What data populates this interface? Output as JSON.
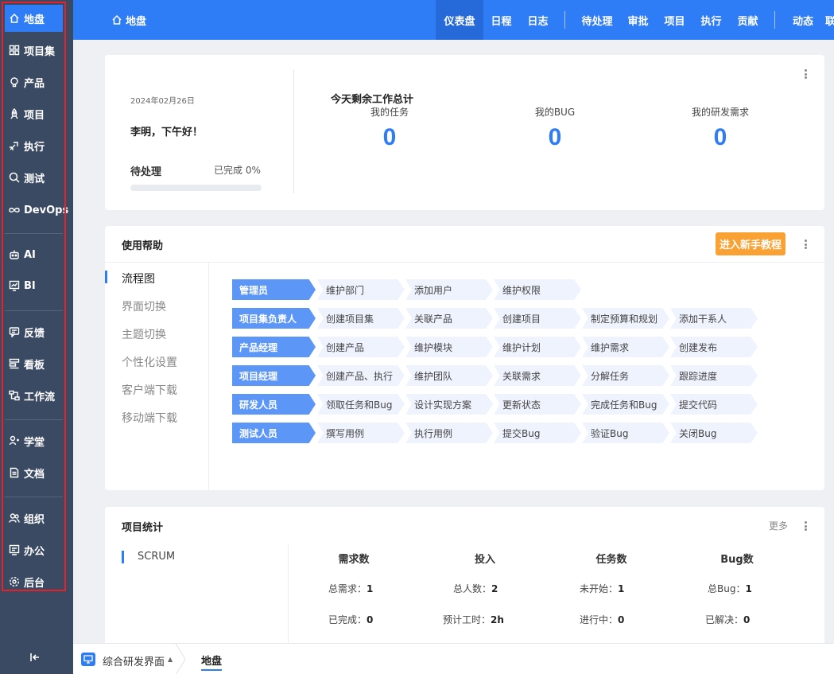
{
  "sidebar": {
    "items": [
      {
        "label": "地盘",
        "icon": "home-icon",
        "active": true
      },
      {
        "label": "项目集",
        "icon": "grid-icon"
      },
      {
        "label": "产品",
        "icon": "lightbulb-icon"
      },
      {
        "label": "项目",
        "icon": "rocket-icon"
      },
      {
        "label": "执行",
        "icon": "execute-icon"
      },
      {
        "label": "测试",
        "icon": "search-icon"
      },
      {
        "label": "DevOps",
        "icon": "infinity-icon"
      },
      {
        "label": "AI",
        "icon": "robot-icon"
      },
      {
        "label": "BI",
        "icon": "chart-icon"
      },
      {
        "label": "反馈",
        "icon": "feedback-icon"
      },
      {
        "label": "看板",
        "icon": "kanban-icon"
      },
      {
        "label": "工作流",
        "icon": "workflow-icon"
      },
      {
        "label": "学堂",
        "icon": "school-icon"
      },
      {
        "label": "文档",
        "icon": "document-icon"
      },
      {
        "label": "组织",
        "icon": "people-icon"
      },
      {
        "label": "办公",
        "icon": "office-icon"
      },
      {
        "label": "后台",
        "icon": "gear-icon"
      }
    ],
    "collapse_icon": "collapse-icon"
  },
  "topbar": {
    "title": "地盘",
    "tabs": [
      "仪表盘",
      "日程",
      "日志",
      "待处理",
      "审批",
      "项目",
      "执行",
      "贡献",
      "动态",
      "联"
    ],
    "active_tab": "仪表盘"
  },
  "summary": {
    "date": "2024年02月26日",
    "greeting": "李明，下午好！",
    "pending_label": "待处理",
    "done_label": "已完成 0%",
    "progress": 0,
    "total_title": "今天剩余工作总计",
    "stats": [
      {
        "label": "我的任务",
        "value": "0"
      },
      {
        "label": "我的BUG",
        "value": "0"
      },
      {
        "label": "我的研发需求",
        "value": "0"
      }
    ]
  },
  "help": {
    "title": "使用帮助",
    "tutorial_button": "进入新手教程",
    "menu": [
      "流程图",
      "界面切换",
      "主题切换",
      "个性化设置",
      "客户端下载",
      "移动端下载"
    ],
    "active_menu": "流程图",
    "flows": [
      {
        "role": "管理员",
        "steps": [
          "维护部门",
          "添加用户",
          "维护权限"
        ]
      },
      {
        "role": "项目集负责人",
        "steps": [
          "创建项目集",
          "关联产品",
          "创建项目",
          "制定预算和规划",
          "添加干系人"
        ]
      },
      {
        "role": "产品经理",
        "steps": [
          "创建产品",
          "维护模块",
          "维护计划",
          "维护需求",
          "创建发布"
        ]
      },
      {
        "role": "项目经理",
        "steps": [
          "创建产品、执行",
          "维护团队",
          "关联需求",
          "分解任务",
          "跟踪进度"
        ]
      },
      {
        "role": "研发人员",
        "steps": [
          "领取任务和Bug",
          "设计实现方案",
          "更新状态",
          "完成任务和Bug",
          "提交代码"
        ]
      },
      {
        "role": "测试人员",
        "steps": [
          "撰写用例",
          "执行用例",
          "提交Bug",
          "验证Bug",
          "关闭Bug"
        ]
      }
    ]
  },
  "project_stats": {
    "title": "项目统计",
    "more": "更多",
    "project": "SCRUM",
    "columns": [
      {
        "head": "需求数",
        "rows": [
          {
            "k": "总需求：",
            "v": "1"
          },
          {
            "k": "已完成：",
            "v": "0"
          }
        ]
      },
      {
        "head": "投入",
        "rows": [
          {
            "k": "总人数：",
            "v": "2"
          },
          {
            "k": "预计工时：",
            "v": "2h"
          }
        ]
      },
      {
        "head": "任务数",
        "rows": [
          {
            "k": "未开始：",
            "v": "1"
          },
          {
            "k": "进行中：",
            "v": "0"
          }
        ]
      },
      {
        "head": "Bug数",
        "rows": [
          {
            "k": "总Bug：",
            "v": "1"
          },
          {
            "k": "已解决：",
            "v": "0"
          }
        ]
      }
    ]
  },
  "bottombar": {
    "interface": "综合研发界面",
    "crumb": "地盘"
  },
  "colors": {
    "primary": "#2e7cf6",
    "sidebar": "#3b4a63",
    "orange": "#f9a233",
    "highlight": "#e8202a"
  }
}
